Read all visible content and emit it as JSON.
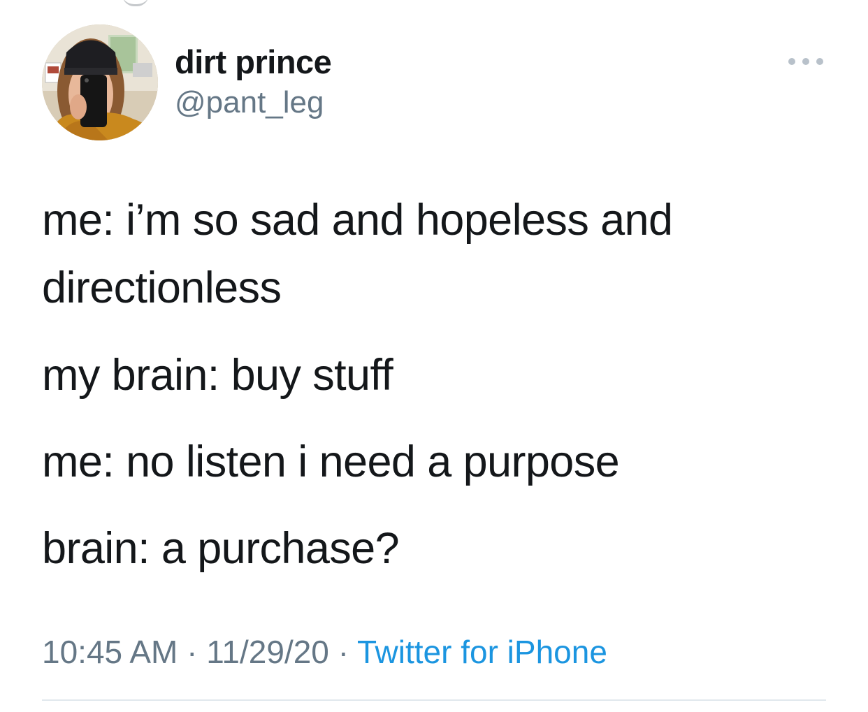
{
  "tweet": {
    "author": {
      "display_name": "dirt prince",
      "handle": "@pant_leg",
      "avatar_icon": "user-avatar-photo"
    },
    "more_icon": "more-options-icon",
    "lines": [
      "me: i’m so sad and hopeless and",
      "directionless",
      "my brain: buy stuff",
      "me: no listen i need a purpose",
      "brain: a purchase?"
    ],
    "time": "10:45 AM",
    "separator": "·",
    "date": "11/29/20",
    "source": "Twitter for iPhone"
  },
  "colors": {
    "text": "#14171a",
    "secondary": "#657786",
    "link": "#1b95e0",
    "divider": "#e1e8ed"
  }
}
